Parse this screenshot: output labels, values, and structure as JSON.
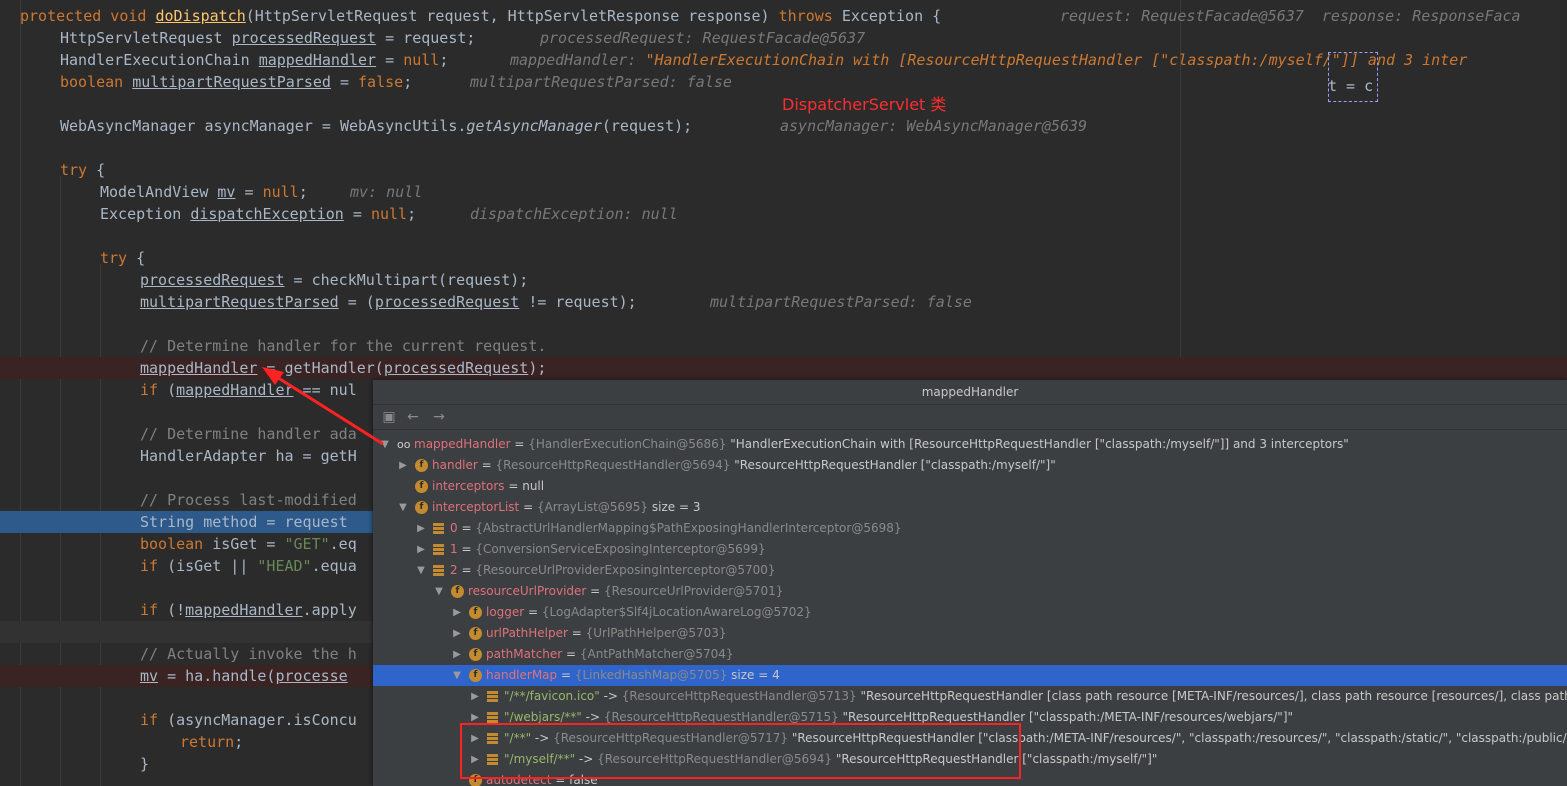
{
  "code": {
    "l1": {
      "kw1": "protected void ",
      "fn": "doDispatch",
      "sig": "(HttpServletRequest request, HttpServletResponse response) ",
      "kw2": "throws ",
      "exc": "Exception {",
      "hint": "request: RequestFacade@5637  response: ResponseFaca"
    },
    "l2": {
      "a": "HttpServletRequest ",
      "v": "processedRequest",
      "b": " = request;",
      "hint": "processedRequest: RequestFacade@5637"
    },
    "l3": {
      "a": "HandlerExecutionChain ",
      "v": "mappedHandler",
      "b": " = ",
      "kw": "null",
      "c": ";",
      "hint": "mappedHandler: ",
      "hintv": "\"HandlerExecutionChain with [ResourceHttpRequestHandler [\"classpath:/myself/\"]] and 3 inter"
    },
    "l4": {
      "kw": "boolean ",
      "v": "multipartRequestParsed",
      "b": " = ",
      "kw2": "false",
      "c": ";",
      "hint": "multipartRequestParsed: false"
    },
    "l4b": {
      "t": "t = c"
    },
    "l5": {
      "a": "WebAsyncManager asyncManager = WebAsyncUtils.",
      "it": "getAsyncManager",
      "b": "(request);",
      "hint": "asyncManager: WebAsyncManager@5639"
    },
    "l6": {
      "kw": "try",
      "b": " {"
    },
    "l7": {
      "a": "ModelAndView ",
      "v": "mv",
      "b": " = ",
      "kw": "null",
      "c": ";",
      "hint": "mv: null"
    },
    "l8": {
      "a": "Exception ",
      "v": "dispatchException",
      "b": " = ",
      "kw": "null",
      "c": ";",
      "hint": "dispatchException: null"
    },
    "l9": {
      "kw": "try",
      "b": " {"
    },
    "l10": {
      "v": "processedRequest",
      "b": " = checkMultipart(request);"
    },
    "l11": {
      "v": "multipartRequestParsed",
      "b": " = (",
      "v2": "processedRequest",
      "c": " != request);",
      "hint": "multipartRequestParsed: false"
    },
    "l12": {
      "cmt": "// Determine handler for the current request."
    },
    "l13": {
      "v": "mappedHandler",
      "b": " = getHandler(",
      "v2": "processedRequest",
      "c": ");"
    },
    "l14": {
      "kw": "if",
      "b": " (",
      "v": "mappedHandler",
      "c": " == nul"
    },
    "l15": {
      "cmt": "// Determine handler ada"
    },
    "l16": {
      "a": "HandlerAdapter ha = getH"
    },
    "l17": {
      "cmt": "// Process last-modified"
    },
    "l18": {
      "a": "String method = request"
    },
    "l19": {
      "kw": "boolean ",
      "a": "isGet = ",
      "str": "\"GET\"",
      "b": ".eq"
    },
    "l20": {
      "kw": "if",
      "a": " (isGet || ",
      "str": "\"HEAD\"",
      "b": ".equa"
    },
    "l21": {
      "kw": "if",
      "a": " (!",
      "v": "mappedHandler",
      "b": ".apply"
    },
    "l22": {
      "cmt": "// Actually invoke the h"
    },
    "l23": {
      "v": "mv",
      "a": " = ha.handle(",
      "v2": "processe"
    },
    "l24": {
      "kw": "if",
      "a": " (asyncManager.isConcu"
    },
    "l25": {
      "kw": "return",
      "a": ";"
    },
    "l26": {
      "a": "}"
    }
  },
  "annotation": "DispatcherServlet 类",
  "popup": {
    "title": "mappedHandler",
    "toolbar": {
      "nav_icon": "▣",
      "back": "←",
      "forward": "→"
    },
    "nodes": [
      {
        "name": "mappedHandler",
        "eq": " = ",
        "type": "{HandlerExecutionChain@5686}",
        "val": " \"HandlerExecutionChain with [ResourceHttpRequestHandler [\"classpath:/myself/\"]] and 3 interceptors\""
      },
      {
        "name": "handler",
        "eq": " = ",
        "type": "{ResourceHttpRequestHandler@5694}",
        "val": " \"ResourceHttpRequestHandler [\"classpath:/myself/\"]\""
      },
      {
        "name": "interceptors",
        "eq": " = ",
        "type": "",
        "val": "null"
      },
      {
        "name": "interceptorList",
        "eq": " = ",
        "type": "{ArrayList@5695}",
        "val": "  size = 3"
      },
      {
        "name": "0",
        "eq": " = ",
        "type": "{AbstractUrlHandlerMapping$PathExposingHandlerInterceptor@5698}",
        "val": ""
      },
      {
        "name": "1",
        "eq": " = ",
        "type": "{ConversionServiceExposingInterceptor@5699}",
        "val": ""
      },
      {
        "name": "2",
        "eq": " = ",
        "type": "{ResourceUrlProviderExposingInterceptor@5700}",
        "val": ""
      },
      {
        "name": "resourceUrlProvider",
        "eq": " = ",
        "type": "{ResourceUrlProvider@5701}",
        "val": ""
      },
      {
        "name": "logger",
        "eq": " = ",
        "type": "{LogAdapter$Slf4jLocationAwareLog@5702}",
        "val": ""
      },
      {
        "name": "urlPathHelper",
        "eq": " = ",
        "type": "{UrlPathHelper@5703}",
        "val": ""
      },
      {
        "name": "pathMatcher",
        "eq": " = ",
        "type": "{AntPathMatcher@5704}",
        "val": ""
      },
      {
        "name": "handlerMap",
        "eq": " = ",
        "type": "{LinkedHashMap@5705}",
        "val": "  size = 4"
      },
      {
        "name": "\"/**/favicon.ico\"",
        "eq": " -> ",
        "type": "{ResourceHttpRequestHandler@5713}",
        "val": " \"ResourceHttpRequestHandler [class path resource [META-INF/resources/], class path resource [resources/], class path reso"
      },
      {
        "name": "\"/webjars/**\"",
        "eq": " -> ",
        "type": "{ResourceHttpRequestHandler@5715}",
        "val": " \"ResourceHttpRequestHandler [\"classpath:/META-INF/resources/webjars/\"]\""
      },
      {
        "name": "\"/**\"",
        "eq": " -> ",
        "type": "{ResourceHttpRequestHandler@5717}",
        "val": " \"ResourceHttpRequestHandler [\"classpath:/META-INF/resources/\", \"classpath:/resources/\", \"classpath:/static/\", \"classpath:/public/\", \"/\"]\""
      },
      {
        "name": "\"/myself/**\"",
        "eq": " -> ",
        "type": "{ResourceHttpRequestHandler@5694}",
        "val": " \"ResourceHttpRequestHandler [\"classpath:/myself/\"]\""
      },
      {
        "name": "autodetect",
        "eq": " = ",
        "type": "",
        "val": "false"
      }
    ]
  }
}
